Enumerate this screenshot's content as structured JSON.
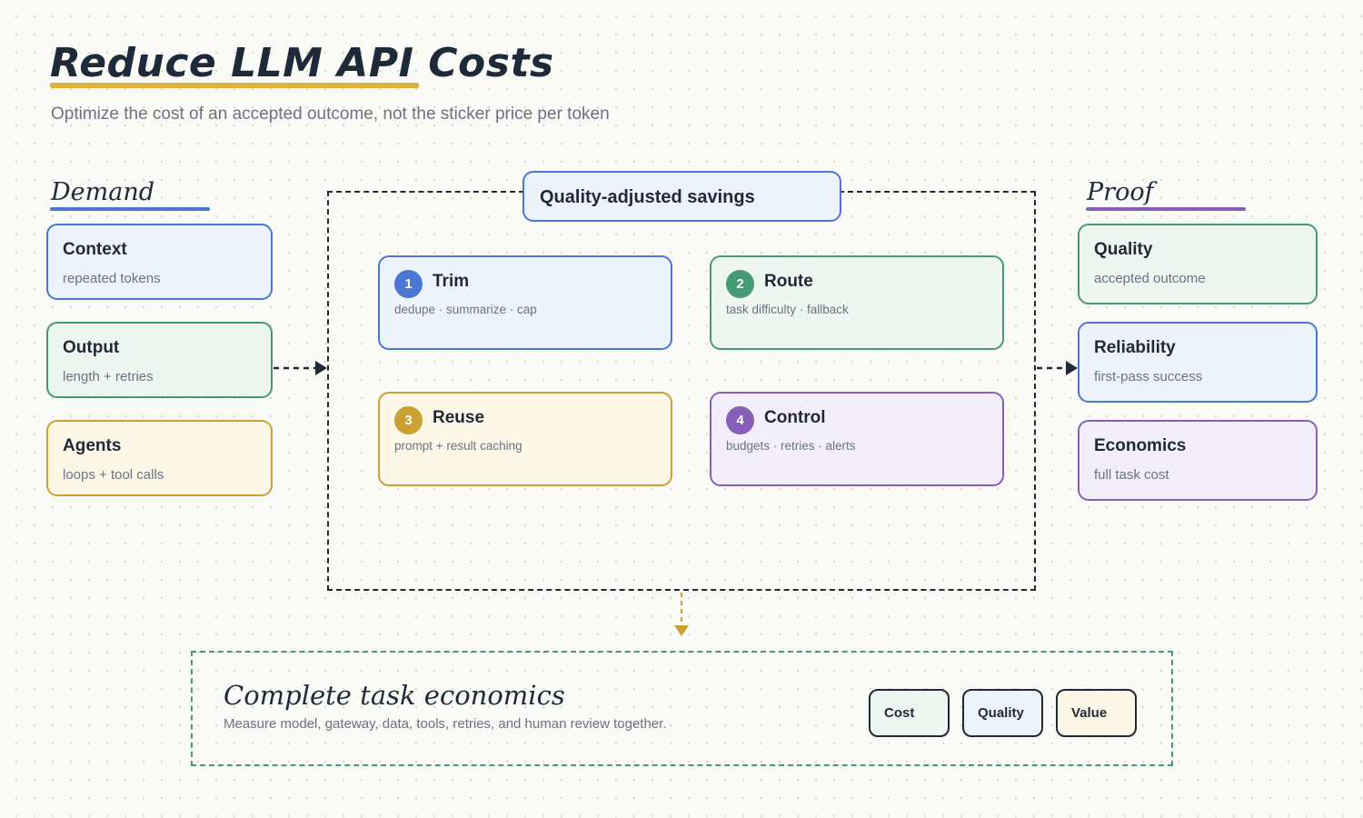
{
  "title": "Reduce LLM API Costs",
  "subtitle": "Optimize the cost of an accepted outcome, not the sticker price per token",
  "demand": {
    "heading": "Demand",
    "items": [
      {
        "title": "Context",
        "sub": "repeated tokens"
      },
      {
        "title": "Output",
        "sub": "length + retries"
      },
      {
        "title": "Agents",
        "sub": "loops + tool calls"
      }
    ]
  },
  "center": {
    "label": "Quality-adjusted savings",
    "steps": [
      {
        "num": "1",
        "title": "Trim",
        "sub": "dedupe · summarize · cap"
      },
      {
        "num": "2",
        "title": "Route",
        "sub": "task difficulty · fallback"
      },
      {
        "num": "3",
        "title": "Reuse",
        "sub": "prompt + result caching"
      },
      {
        "num": "4",
        "title": "Control",
        "sub": "budgets · retries · alerts"
      }
    ]
  },
  "proof": {
    "heading": "Proof",
    "items": [
      {
        "title": "Quality",
        "sub": "accepted outcome"
      },
      {
        "title": "Reliability",
        "sub": "first-pass success"
      },
      {
        "title": "Economics",
        "sub": "full task cost"
      }
    ]
  },
  "bottom": {
    "title": "Complete task economics",
    "sub": "Measure model, gateway, data, tools, retries, and human review together.",
    "pills": [
      "Cost",
      "Quality",
      "Value"
    ]
  },
  "colors": {
    "blue": "#4a77d4",
    "green": "#439a74",
    "yellow": "#c9a232",
    "purple": "#8660b8",
    "ink": "#1f2937",
    "accent_underline": "#dcb23c"
  }
}
